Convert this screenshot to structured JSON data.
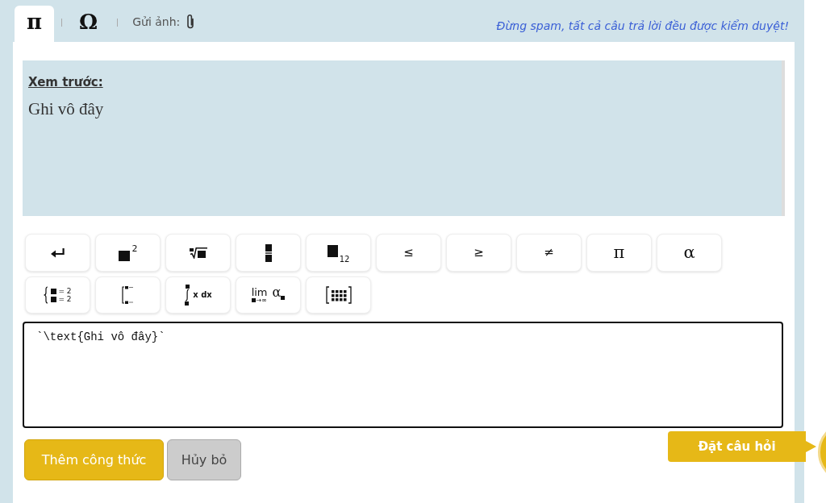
{
  "tabs": [
    {
      "label": "π",
      "selected": true
    },
    {
      "label": "Ω",
      "selected": false
    }
  ],
  "attach": {
    "label": "Gửi ảnh:"
  },
  "notice": "Đừng spam, tất cả câu trả lời đều được kiểm duyệt!",
  "preview": {
    "heading": "Xem trước:",
    "content": "Ghi vô đây"
  },
  "toolbar": [
    [
      {
        "kind": "newline"
      },
      {
        "kind": "power",
        "text": "2"
      },
      {
        "kind": "root"
      },
      {
        "kind": "fraction"
      },
      {
        "kind": "subscript",
        "text": "12"
      },
      {
        "kind": "symbol",
        "text": "≤"
      },
      {
        "kind": "symbol",
        "text": "≥"
      },
      {
        "kind": "symbol",
        "text": "≠"
      },
      {
        "kind": "letter",
        "text": "π"
      },
      {
        "kind": "letter",
        "text": "α"
      }
    ],
    [
      {
        "kind": "system",
        "lines": [
          "= 2",
          "= 2"
        ]
      },
      {
        "kind": "cases"
      },
      {
        "kind": "integral",
        "text": "x dx"
      },
      {
        "kind": "limit",
        "text": "lim",
        "below": "→∞",
        "symbol": "α"
      },
      {
        "kind": "matrix"
      }
    ]
  ],
  "editor": {
    "value": "`\\text{Ghi vô đây}`"
  },
  "actions": [
    {
      "kind": "primary",
      "label": "Thêm công thức"
    },
    {
      "kind": "secondary",
      "label": "Hủy bỏ"
    }
  ],
  "ask_tooltip": {
    "label": "Đặt câu hỏi"
  }
}
